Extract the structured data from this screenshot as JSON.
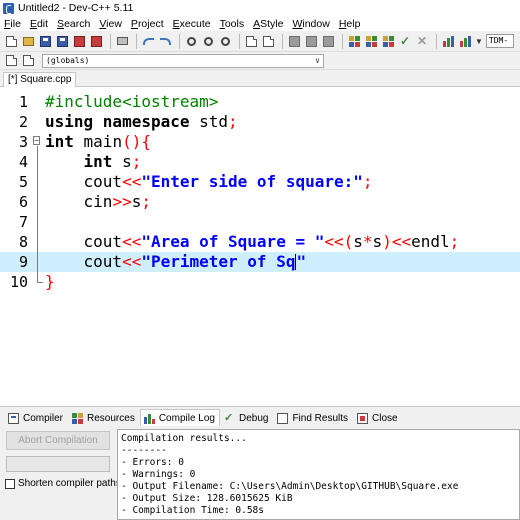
{
  "window": {
    "title": "Untitled2 - Dev-C++ 5.11"
  },
  "menu": [
    {
      "pre": "",
      "ul": "F",
      "post": "ile"
    },
    {
      "pre": "",
      "ul": "E",
      "post": "dit"
    },
    {
      "pre": "",
      "ul": "S",
      "post": "earch"
    },
    {
      "pre": "",
      "ul": "V",
      "post": "iew"
    },
    {
      "pre": "",
      "ul": "P",
      "post": "roject"
    },
    {
      "pre": "",
      "ul": "E",
      "post": "xecute"
    },
    {
      "pre": "",
      "ul": "T",
      "post": "ools"
    },
    {
      "pre": "",
      "ul": "A",
      "post": "Style"
    },
    {
      "pre": "",
      "ul": "W",
      "post": "indow"
    },
    {
      "pre": "",
      "ul": "H",
      "post": "elp"
    }
  ],
  "toolbar": {
    "compiler_value": "TDM-",
    "scope_value": "(globals)"
  },
  "tabs": {
    "file_tab": "[*] Square.cpp"
  },
  "editor": {
    "lines": [
      {
        "no": "1",
        "tokens": [
          {
            "t": "#include<iostream>",
            "c": "pre"
          }
        ]
      },
      {
        "no": "2",
        "tokens": [
          {
            "t": "using namespace",
            "c": "kw"
          },
          {
            "t": " std",
            "c": "plain"
          },
          {
            "t": ";",
            "c": "sym"
          }
        ]
      },
      {
        "no": "3",
        "tokens": [
          {
            "t": "int",
            "c": "kw"
          },
          {
            "t": " main",
            "c": "plain"
          },
          {
            "t": "(){",
            "c": "sym"
          }
        ]
      },
      {
        "no": "4",
        "tokens": [
          {
            "t": "    ",
            "c": "plain"
          },
          {
            "t": "int",
            "c": "kw"
          },
          {
            "t": " s",
            "c": "plain"
          },
          {
            "t": ";",
            "c": "sym"
          }
        ]
      },
      {
        "no": "5",
        "tokens": [
          {
            "t": "    cout",
            "c": "plain"
          },
          {
            "t": "<<",
            "c": "sym"
          },
          {
            "t": "\"Enter side of square:\"",
            "c": "str"
          },
          {
            "t": ";",
            "c": "sym"
          }
        ]
      },
      {
        "no": "6",
        "tokens": [
          {
            "t": "    cin",
            "c": "plain"
          },
          {
            "t": ">>",
            "c": "sym"
          },
          {
            "t": "s",
            "c": "plain"
          },
          {
            "t": ";",
            "c": "sym"
          }
        ]
      },
      {
        "no": "7",
        "tokens": []
      },
      {
        "no": "8",
        "tokens": [
          {
            "t": "    cout",
            "c": "plain"
          },
          {
            "t": "<<",
            "c": "sym"
          },
          {
            "t": "\"Area of Square = \"",
            "c": "str"
          },
          {
            "t": "<<(",
            "c": "sym"
          },
          {
            "t": "s",
            "c": "plain"
          },
          {
            "t": "*",
            "c": "sym"
          },
          {
            "t": "s",
            "c": "plain"
          },
          {
            "t": ")<<",
            "c": "sym"
          },
          {
            "t": "endl",
            "c": "plain"
          },
          {
            "t": ";",
            "c": "sym"
          }
        ]
      },
      {
        "no": "9",
        "tokens": [
          {
            "t": "    cout",
            "c": "plain"
          },
          {
            "t": "<<",
            "c": "sym"
          },
          {
            "t": "\"Perimeter of Sq",
            "c": "str"
          },
          {
            "t": "CARET",
            "c": "caret"
          },
          {
            "t": "\"",
            "c": "str"
          }
        ]
      },
      {
        "no": "10",
        "tokens": [
          {
            "t": "}",
            "c": "sym"
          }
        ]
      }
    ],
    "current_line": 9
  },
  "bottom_tabs": [
    {
      "name": "compiler",
      "label": "Compiler",
      "active": false
    },
    {
      "name": "resources",
      "label": "Resources",
      "active": false
    },
    {
      "name": "compile-log",
      "label": "Compile Log",
      "active": true
    },
    {
      "name": "debug",
      "label": "Debug",
      "active": false
    },
    {
      "name": "find-results",
      "label": "Find Results",
      "active": false
    },
    {
      "name": "close",
      "label": "Close",
      "active": false
    }
  ],
  "compile_panel": {
    "abort_label": "Abort Compilation",
    "progress_fraction": 0,
    "shorten_label": "Shorten compiler paths",
    "log_lines": [
      "Compilation results...",
      "--------",
      "- Errors: 0",
      "- Warnings: 0",
      "- Output Filename: C:\\Users\\Admin\\Desktop\\GITHUB\\Square.exe",
      "- Output Size: 128.6015625 KiB",
      "- Compilation Time: 0.58s"
    ]
  }
}
